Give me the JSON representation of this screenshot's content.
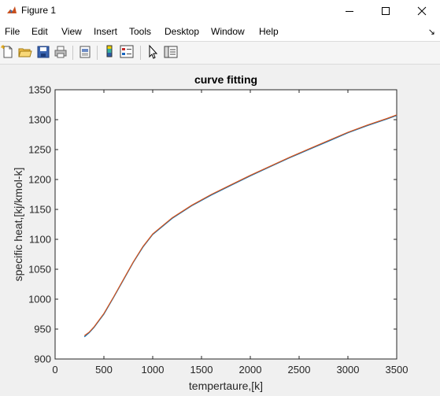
{
  "window": {
    "title": "Figure 1"
  },
  "menu": [
    "File",
    "Edit",
    "View",
    "Insert",
    "Tools",
    "Desktop",
    "Window",
    "Help"
  ],
  "dock_arrow": "↘",
  "toolbar_icons": [
    "new-figure-icon",
    "open-file-icon",
    "save-icon",
    "print-icon",
    "print-preview-icon",
    "colorbar-icon",
    "legend-icon",
    "pointer-icon",
    "property-editor-icon"
  ],
  "chart_data": {
    "type": "line",
    "title": "curve fitting",
    "xlabel": "tempertaure,[k]",
    "ylabel": "specific heat,[kj/kmol-k]",
    "xlim": [
      0,
      3500
    ],
    "ylim": [
      900,
      1350
    ],
    "xticks": [
      0,
      500,
      1000,
      1500,
      2000,
      2500,
      3000,
      3500
    ],
    "yticks": [
      900,
      950,
      1000,
      1050,
      1100,
      1150,
      1200,
      1250,
      1300,
      1350
    ],
    "grid": false,
    "series": [
      {
        "color": "#0072bd",
        "x": [
          300,
          350,
          400,
          500,
          600,
          700,
          800,
          900,
          1000,
          1200,
          1400,
          1600,
          1800,
          2000,
          2200,
          2400,
          2600,
          2800,
          3000,
          3200,
          3400,
          3500
        ],
        "y": [
          937,
          944,
          953,
          975,
          1003,
          1032,
          1061,
          1087,
          1108,
          1135,
          1156,
          1174,
          1190,
          1206,
          1221,
          1236,
          1250,
          1264,
          1278,
          1290,
          1301,
          1307
        ]
      },
      {
        "color": "#d95319",
        "x": [
          300,
          350,
          400,
          500,
          600,
          700,
          800,
          900,
          1000,
          1200,
          1400,
          1600,
          1800,
          2000,
          2200,
          2400,
          2600,
          2800,
          3000,
          3200,
          3400,
          3500
        ],
        "y": [
          939,
          945,
          954,
          976,
          1004,
          1033,
          1062,
          1088,
          1109,
          1136,
          1157,
          1175,
          1191,
          1207,
          1222,
          1237,
          1251,
          1265,
          1279,
          1291,
          1302,
          1308
        ]
      }
    ]
  }
}
